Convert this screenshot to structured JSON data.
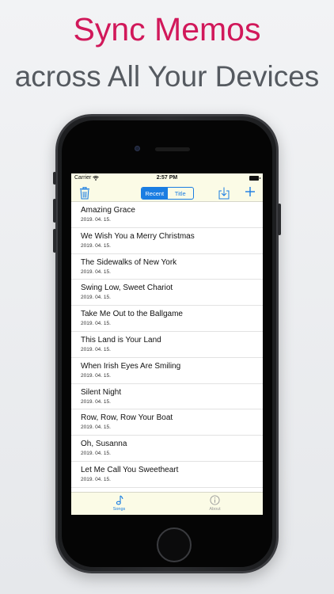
{
  "headline": {
    "line1": "Sync Memos",
    "line2": "across All Your Devices"
  },
  "status_bar": {
    "carrier": "Carrier",
    "time": "2:57 PM"
  },
  "toolbar": {
    "segments": [
      {
        "label": "Recent",
        "selected": true
      },
      {
        "label": "Title",
        "selected": false
      }
    ]
  },
  "songs": [
    {
      "title": "Amazing Grace",
      "date": "2019. 04. 15."
    },
    {
      "title": "We Wish You a Merry Christmas",
      "date": "2019. 04. 15."
    },
    {
      "title": "The Sidewalks of New York",
      "date": "2019. 04. 15."
    },
    {
      "title": "Swing Low, Sweet Chariot",
      "date": "2019. 04. 15."
    },
    {
      "title": "Take Me Out to the Ballgame",
      "date": "2019. 04. 15."
    },
    {
      "title": "This Land is Your Land",
      "date": "2019. 04. 15."
    },
    {
      "title": "When Irish Eyes Are Smiling",
      "date": "2019. 04. 15."
    },
    {
      "title": "Silent Night",
      "date": "2019. 04. 15."
    },
    {
      "title": "Row, Row, Row Your Boat",
      "date": "2019. 04. 15."
    },
    {
      "title": "Oh, Susanna",
      "date": "2019. 04. 15."
    },
    {
      "title": "Let Me Call You Sweetheart",
      "date": "2019. 04. 15."
    }
  ],
  "tabbar": {
    "tabs": [
      {
        "label": "Songs",
        "icon": "music-note-icon",
        "active": true
      },
      {
        "label": "About",
        "icon": "info-icon",
        "active": false
      }
    ]
  },
  "colors": {
    "headline_accent": "#d1185a",
    "headline_secondary": "#555a60",
    "ios_blue": "#1a7de2",
    "bar_background": "#fbfbe6"
  }
}
